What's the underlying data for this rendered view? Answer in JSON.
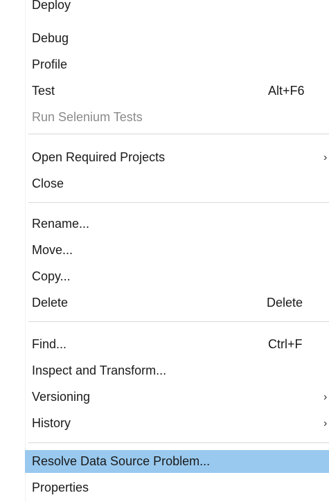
{
  "menu": {
    "items": {
      "deploy": {
        "label": "Deploy"
      },
      "debug": {
        "label": "Debug"
      },
      "profile": {
        "label": "Profile"
      },
      "test": {
        "label": "Test",
        "shortcut": "Alt+F6"
      },
      "run_selenium": {
        "label": "Run Selenium Tests"
      },
      "open_required": {
        "label": "Open Required Projects",
        "arrow": "›"
      },
      "close": {
        "label": "Close"
      },
      "rename": {
        "label": "Rename..."
      },
      "move": {
        "label": "Move..."
      },
      "copy": {
        "label": "Copy..."
      },
      "delete": {
        "label": "Delete",
        "shortcut": "Delete"
      },
      "find": {
        "label": "Find...",
        "shortcut": "Ctrl+F"
      },
      "inspect": {
        "label": "Inspect and Transform..."
      },
      "versioning": {
        "label": "Versioning",
        "arrow": "›"
      },
      "history": {
        "label": "History",
        "arrow": "›"
      },
      "resolve": {
        "label": "Resolve Data Source Problem..."
      },
      "properties": {
        "label": "Properties"
      }
    }
  },
  "colors": {
    "highlight": "#99c9ef",
    "disabled_text": "#8a8a8a",
    "separator": "#d8d8d8"
  }
}
